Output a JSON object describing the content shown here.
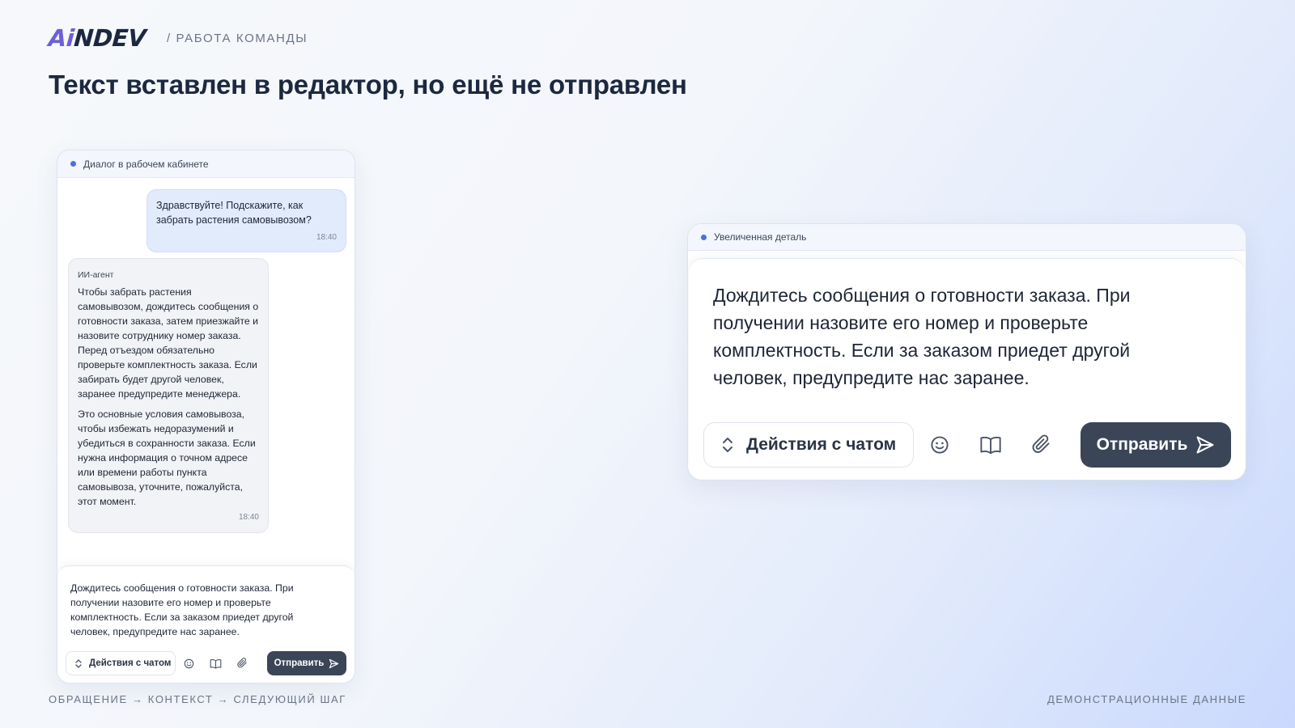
{
  "header": {
    "logo_ai": "Ai",
    "logo_rest": "NDEV",
    "breadcrumb": "/ РАБОТА КОМАНДЫ",
    "title": "Текст вставлен в редактор, но ещё не отправлен"
  },
  "chat_panel": {
    "title": "Диалог в рабочем кабинете",
    "user_message": {
      "text": "Здравствуйте! Подскажите, как забрать растения самовывозом?",
      "time": "18:40"
    },
    "bot_message": {
      "sender": "ИИ-агент",
      "paragraph1": "Чтобы забрать растения самовывозом, дождитесь сообщения о готовности заказа, затем приезжайте и назовите сотруднику номер заказа. Перед отъездом обязательно проверьте комплектность заказа. Если забирать будет другой человек, заранее предупредите менеджера.",
      "paragraph2": "Это основные условия самовывоза, чтобы избежать недоразумений и убедиться в сохранности заказа. Если нужна информация о точном адресе или времени работы пункта самовывоза, уточните, пожалуйста, этот момент.",
      "time": "18:40"
    },
    "composer": {
      "text": "Дождитесь сообщения о готовности заказа. При получении назовите его номер и проверьте комплектность. Если за заказом приедет другой человек, предупредите нас заранее.",
      "actions_label": "Действия с чатом",
      "send_label": "Отправить"
    }
  },
  "zoom_panel": {
    "title": "Увеличенная деталь",
    "text": "Дождитесь сообщения о готовности заказа. При получении назовите его номер и проверьте комплектность. Если за заказом приедет другой человек, предупредите нас заранее.",
    "actions_label": "Действия с чатом",
    "send_label": "Отправить"
  },
  "footer": {
    "left": "ОБРАЩЕНИЕ → КОНТЕКСТ → СЛЕДУЮЩИЙ ШАГ",
    "right": "ДЕМОНСТРАЦИОННЫЕ ДАННЫЕ"
  },
  "colors": {
    "accent": "#6f5fd8",
    "dark": "#1c2840",
    "send_button": "#3a4658",
    "status_dot": "#4a72d8",
    "user_bubble": "#e2ebfc"
  },
  "icons": [
    "chevron-updown-icon",
    "smile-icon",
    "book-icon",
    "paperclip-icon",
    "send-icon"
  ]
}
